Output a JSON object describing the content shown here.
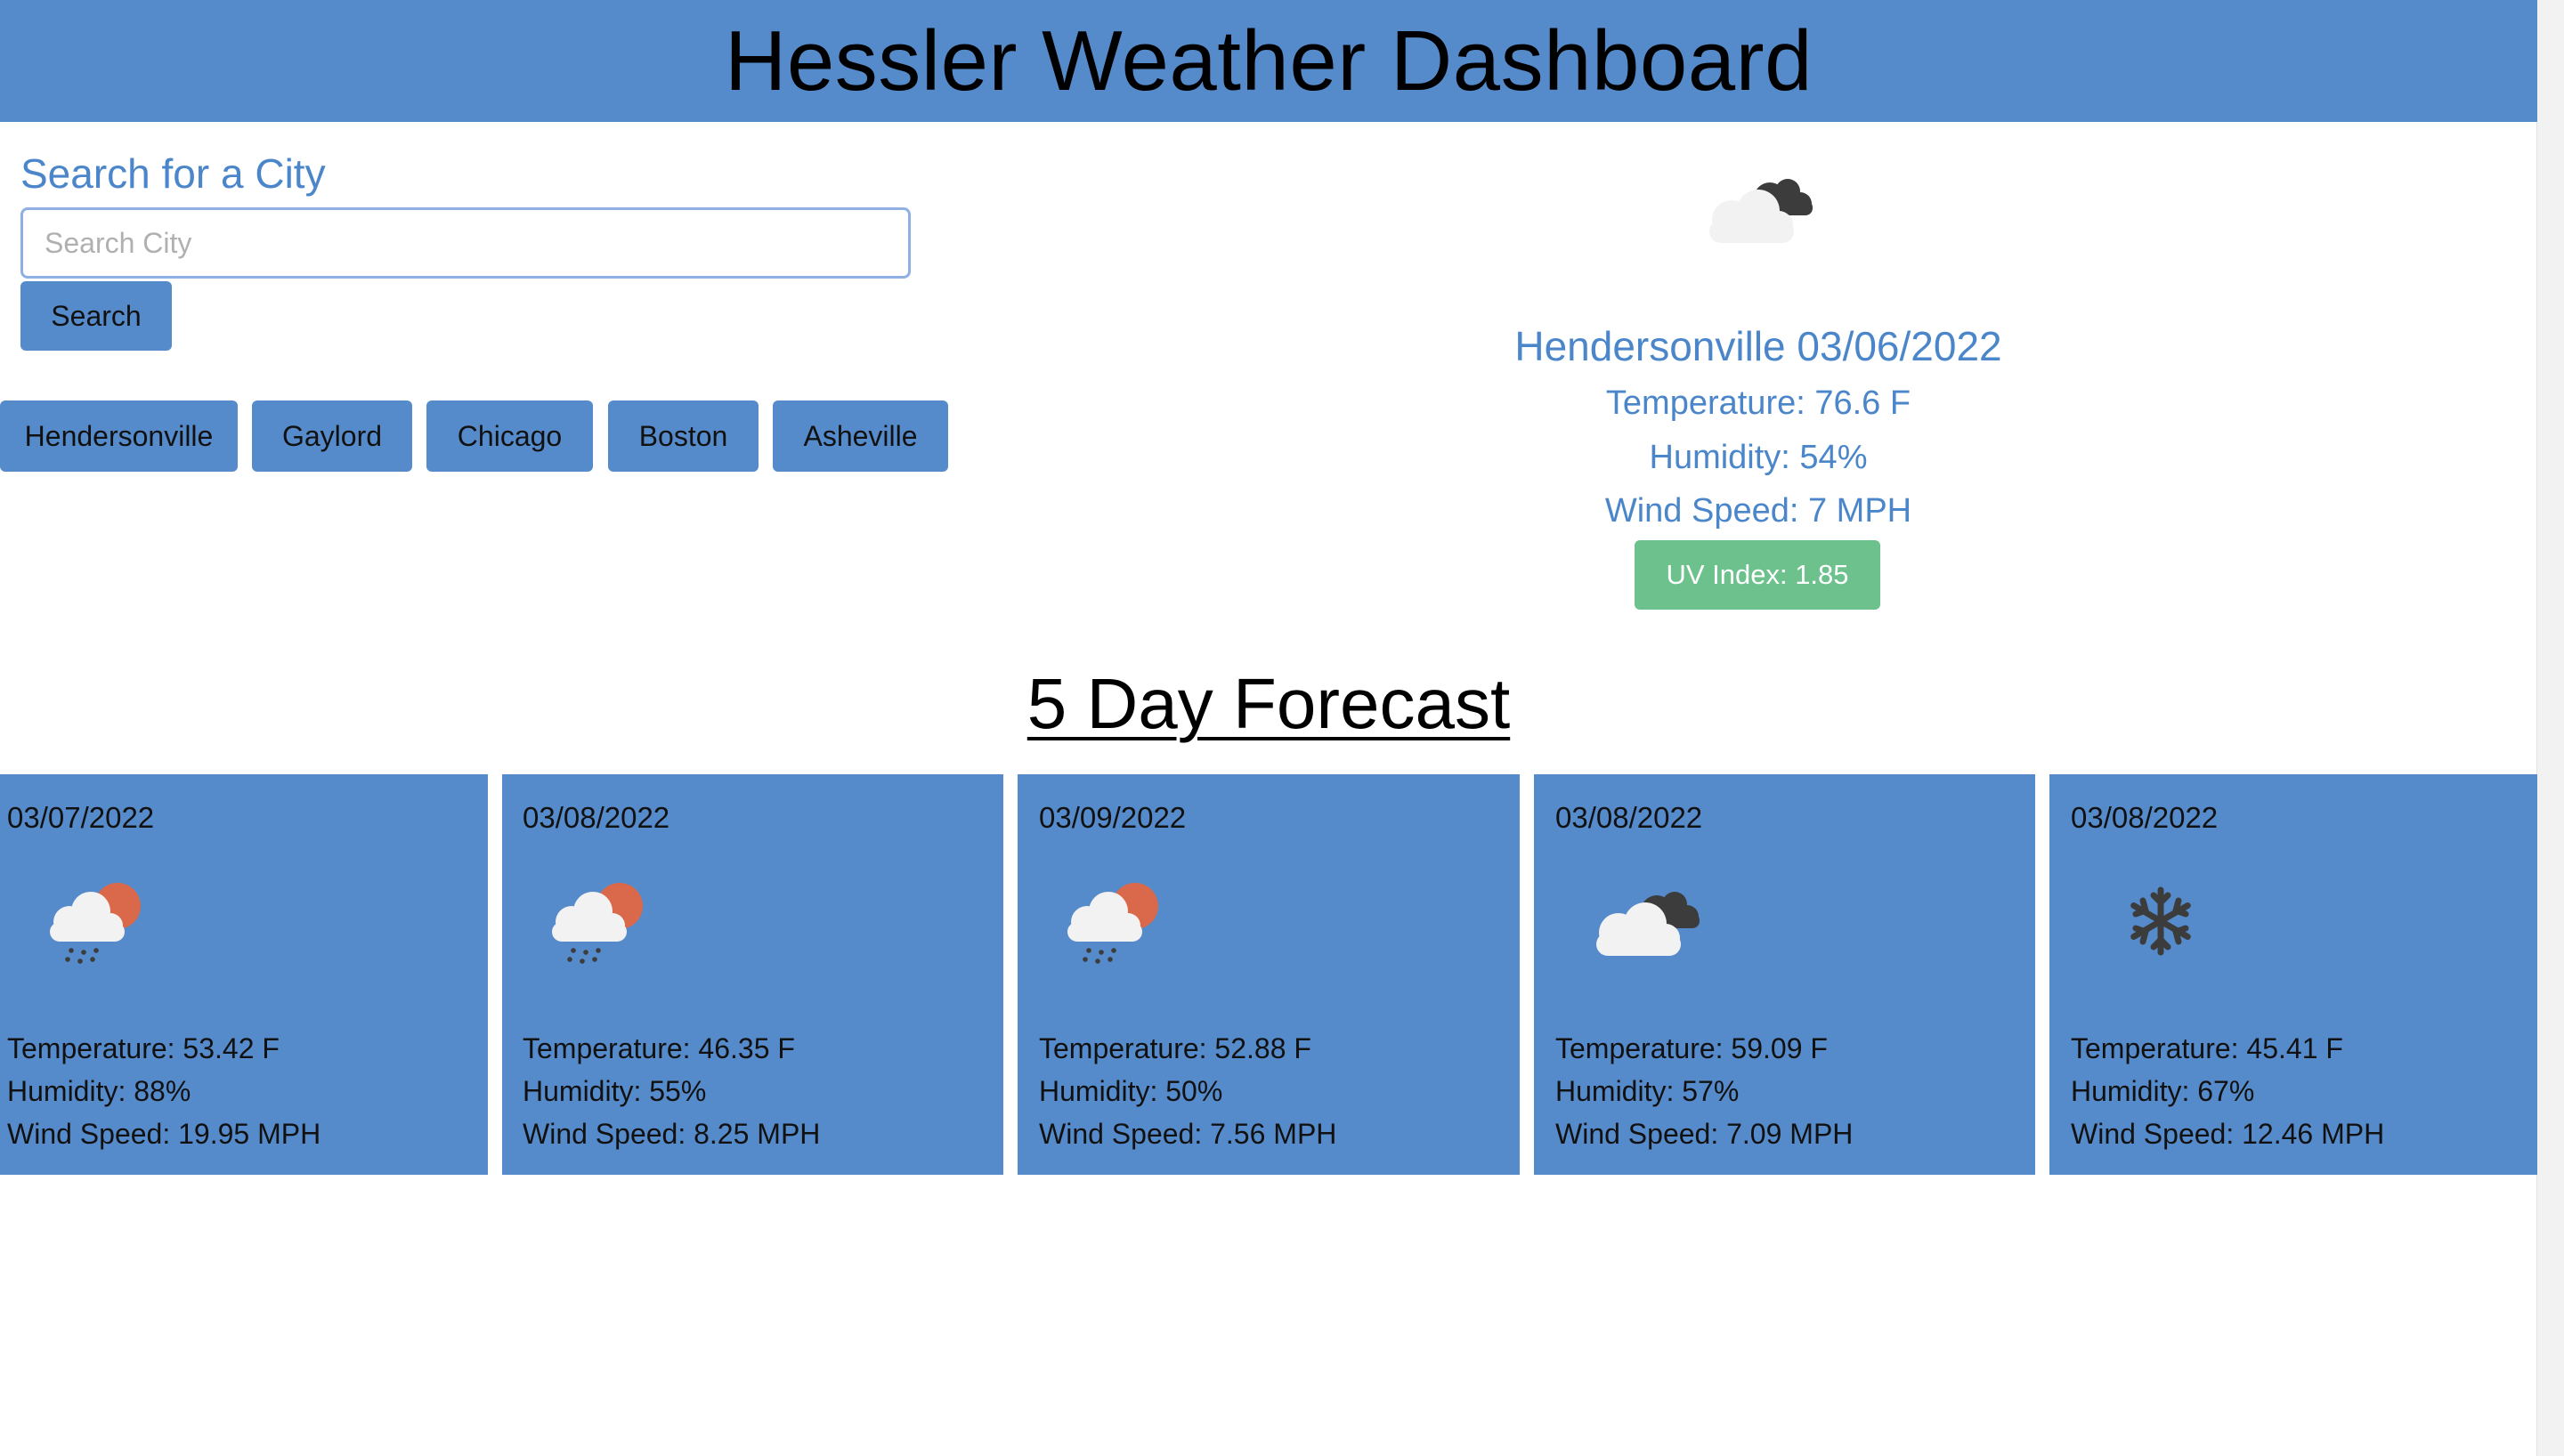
{
  "header": {
    "title": "Hessler Weather Dashboard"
  },
  "search": {
    "label": "Search for a City",
    "placeholder": "Search City",
    "value": "",
    "button_label": "Search"
  },
  "history": [
    {
      "label": "Hendersonville"
    },
    {
      "label": "Gaylord"
    },
    {
      "label": "Chicago"
    },
    {
      "label": "Boston"
    },
    {
      "label": "Asheville"
    }
  ],
  "current": {
    "icon": "cloudy-icon",
    "city_date": "Hendersonville 03/06/2022",
    "temperature": "Temperature: 76.6 F",
    "humidity": "Humidity: 54%",
    "wind": "Wind Speed: 7 MPH",
    "uv": "UV Index: 1.85"
  },
  "forecast": {
    "title": "5 Day Forecast",
    "days": [
      {
        "date": "03/07/2022",
        "icon": "rain-icon",
        "temperature": "Temperature: 53.42 F",
        "humidity": "Humidity: 88%",
        "wind": "Wind Speed: 19.95 MPH"
      },
      {
        "date": "03/08/2022",
        "icon": "rain-icon",
        "temperature": "Temperature: 46.35 F",
        "humidity": "Humidity: 55%",
        "wind": "Wind Speed: 8.25 MPH"
      },
      {
        "date": "03/09/2022",
        "icon": "rain-icon",
        "temperature": "Temperature: 52.88 F",
        "humidity": "Humidity: 50%",
        "wind": "Wind Speed: 7.56 MPH"
      },
      {
        "date": "03/08/2022",
        "icon": "cloudy-icon",
        "temperature": "Temperature: 59.09 F",
        "humidity": "Humidity: 57%",
        "wind": "Wind Speed: 7.09 MPH"
      },
      {
        "date": "03/08/2022",
        "icon": "snow-icon",
        "temperature": "Temperature: 45.41 F",
        "humidity": "Humidity: 67%",
        "wind": "Wind Speed: 12.46 MPH"
      }
    ]
  },
  "colors": {
    "primary": "#568bcb",
    "accent_text": "#4a86c9",
    "uv_good": "#6cc18d"
  }
}
